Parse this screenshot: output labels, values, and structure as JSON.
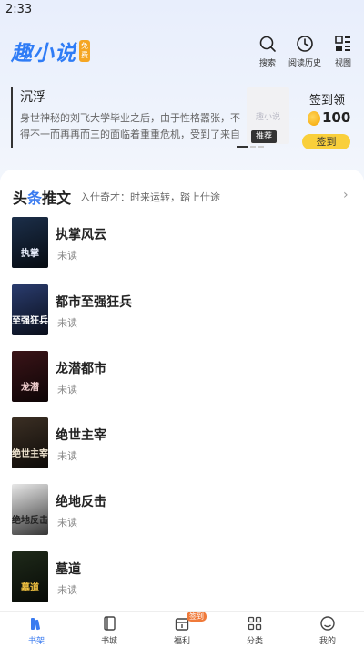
{
  "status_bar": {
    "time": "2:33"
  },
  "header": {
    "logo_text": "趣小说",
    "logo_badge": "免费",
    "actions": [
      {
        "label": "搜索",
        "icon": "search-icon"
      },
      {
        "label": "阅读历史",
        "icon": "history-icon"
      },
      {
        "label": "视图",
        "icon": "view-grid-icon"
      }
    ]
  },
  "recommend": {
    "title": "沉浮",
    "description": "身世神秘的刘飞大学毕业之后，由于性格嚣张，不得不一而再再而三的面临着重重危机，受到了来自各方面的…",
    "cover_text": "趣小说",
    "tag": "推荐"
  },
  "signin": {
    "label": "签到领",
    "coins": "100",
    "button": "签到",
    "coin_color": "#f5a400",
    "button_color": "#f9cf3b"
  },
  "section": {
    "title_a": "头",
    "title_b": "条",
    "title_c": "推文",
    "subtitle": "入仕奇才：时来运转，踏上仕途",
    "arrow": "›"
  },
  "books": [
    {
      "title": "执掌风云",
      "status": "未读",
      "cover_text": "执掌",
      "cover_bg": "#1c2f4a",
      "cover_fg": "#e8eefc"
    },
    {
      "title": "都市至强狂兵",
      "status": "未读",
      "cover_text": "至强狂兵",
      "cover_bg": "#2a3c6e",
      "cover_fg": "#ffffff"
    },
    {
      "title": "龙潜都市",
      "status": "未读",
      "cover_text": "龙潜",
      "cover_bg": "#3a1418",
      "cover_fg": "#f2d0d0"
    },
    {
      "title": "绝世主宰",
      "status": "未读",
      "cover_text": "绝世主宰",
      "cover_bg": "#3b2f24",
      "cover_fg": "#f1e6d2"
    },
    {
      "title": "绝地反击",
      "status": "未读",
      "cover_text": "绝地反击",
      "cover_bg": "#e8e8e8",
      "cover_fg": "#222222"
    },
    {
      "title": "墓道",
      "status": "未读",
      "cover_text": "墓道",
      "cover_bg": "#1f2a1a",
      "cover_fg": "#f5c542"
    }
  ],
  "tabbar": {
    "items": [
      {
        "label": "书架",
        "icon": "bookshelf-icon",
        "active": true
      },
      {
        "label": "书城",
        "icon": "bookstore-icon",
        "active": false
      },
      {
        "label": "福利",
        "icon": "gift-calendar-icon",
        "active": false
      },
      {
        "label": "分类",
        "icon": "category-grid-icon",
        "active": false
      },
      {
        "label": "我的",
        "icon": "profile-icon",
        "active": false
      }
    ],
    "badge": "签到",
    "accent": "#3a7bf0"
  }
}
